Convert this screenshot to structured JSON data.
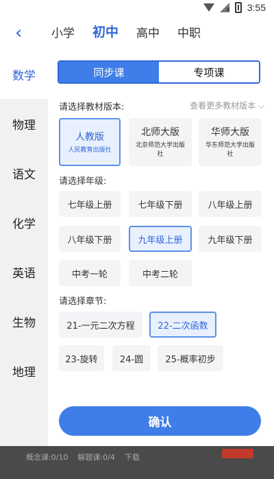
{
  "status_bar": {
    "time": "3:55",
    "icons": [
      "wifi-icon",
      "signal-icon",
      "battery-icon"
    ]
  },
  "header": {
    "back_icon": "chevron-left-icon",
    "levels": [
      {
        "label": "小学",
        "active": false
      },
      {
        "label": "初中",
        "active": true
      },
      {
        "label": "高中",
        "active": false
      },
      {
        "label": "中职",
        "active": false
      }
    ]
  },
  "sidebar": {
    "items": [
      {
        "label": "数学",
        "active": true
      },
      {
        "label": "物理",
        "active": false
      },
      {
        "label": "语文",
        "active": false
      },
      {
        "label": "化学",
        "active": false
      },
      {
        "label": "英语",
        "active": false
      },
      {
        "label": "生物",
        "active": false
      },
      {
        "label": "地理",
        "active": false
      }
    ]
  },
  "mode_tabs": [
    {
      "label": "同步课",
      "active": true
    },
    {
      "label": "专项课",
      "active": false
    }
  ],
  "edition_section": {
    "label": "请选择教材版本:",
    "more_link": "查看更多教材版本",
    "options": [
      {
        "title": "人教版",
        "subtitle": "人民教育出版社",
        "selected": true
      },
      {
        "title": "北师大版",
        "subtitle": "北京师范大学出版社",
        "selected": false
      },
      {
        "title": "华师大版",
        "subtitle": "华东师范大学出版社",
        "selected": false
      }
    ]
  },
  "grade_section": {
    "label": "请选择年级:",
    "options": [
      {
        "label": "七年级上册",
        "selected": false
      },
      {
        "label": "七年级下册",
        "selected": false
      },
      {
        "label": "八年级上册",
        "selected": false
      },
      {
        "label": "八年级下册",
        "selected": false
      },
      {
        "label": "九年级上册",
        "selected": true
      },
      {
        "label": "九年级下册",
        "selected": false
      },
      {
        "label": "中考一轮",
        "selected": false
      },
      {
        "label": "中考二轮",
        "selected": false
      }
    ]
  },
  "chapter_section": {
    "label": "请选择章节:",
    "options": [
      {
        "label": "21-一元二次方程",
        "selected": false
      },
      {
        "label": "22-二次函数",
        "selected": true
      },
      {
        "label": "23-旋转",
        "selected": false
      },
      {
        "label": "24-圆",
        "selected": false
      },
      {
        "label": "25-概率初步",
        "selected": false
      }
    ]
  },
  "confirm_button": {
    "label": "确认"
  },
  "bottom_bar": {
    "concept": "概念课:0/10",
    "explain": "解题课:0/4",
    "download": "下载"
  },
  "colors": {
    "accent": "#3f7ee8",
    "selected_bg": "#e8f0fd",
    "pill_bg": "#f3f4f6"
  }
}
